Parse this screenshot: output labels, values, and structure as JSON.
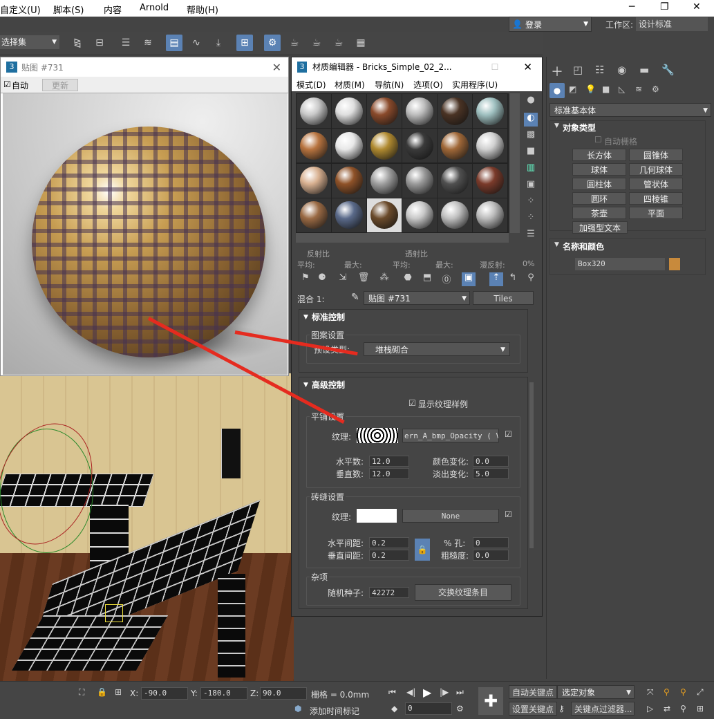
{
  "menubar": {
    "items": [
      "自定义(U)",
      "脚本(S)",
      "内容",
      "Arnold",
      "帮助(H)"
    ],
    "login": "登录",
    "workspace_label": "工作区:",
    "workspace_value": "设计标准"
  },
  "toolbar": {
    "selection_set": "选择集"
  },
  "map_window": {
    "title": "贴图 #731",
    "auto_label": "自动",
    "update_label": "更新"
  },
  "material_editor": {
    "title": "材质编辑器 - Bricks_Simple_02_2...",
    "menu": [
      "模式(D)",
      "材质(M)",
      "导航(N)",
      "选项(O)",
      "实用程序(U)"
    ],
    "reflect_label": "反射比",
    "transmit_label": "透射比",
    "avg_label": "平均:",
    "max_label": "最大:",
    "diffuse_label": "漫反射:",
    "diffuse_value": "0%",
    "mix_label": "混合 1:",
    "map_dropdown": "贴图 #731",
    "map_type_button": "Tiles",
    "standard_controls": {
      "title": "标准控制",
      "pattern_group": "图案设置",
      "preset_label": "预设类型:",
      "preset_value": "堆栈砌合"
    },
    "advanced_controls": {
      "title": "高级控制",
      "show_texture_swatches": "显示纹理样例",
      "tiles_setup_group": "平铺设置",
      "texture_label": "纹理:",
      "texture_map": "ern_A_bmp_Opacity  ( VR",
      "horiz_count_label": "水平数:",
      "horiz_count": "12.0",
      "vert_count_label": "垂直数:",
      "vert_count": "12.0",
      "color_var_label": "颜色变化:",
      "color_var": "0.0",
      "fade_var_label": "淡出变化:",
      "fade_var": "5.0",
      "grout_group": "砖缝设置",
      "grout_texture_label": "纹理:",
      "grout_map": "None",
      "h_gap_label": "水平间距:",
      "h_gap": "0.2",
      "v_gap_label": "垂直间距:",
      "v_gap": "0.2",
      "holes_label": "% 孔:",
      "holes": "0",
      "rough_label": "粗糙度:",
      "rough": "0.0",
      "misc_group": "杂项",
      "seed_label": "随机种子:",
      "seed": "42272",
      "swap_button": "交换纹理条目"
    },
    "slot_colors": [
      "#c9c9c9",
      "#dedede",
      "#8a4a2b",
      "#bdbdbd",
      "#4a3324",
      "#9fc0c0",
      "#b8743f",
      "#e8e8e8",
      "#b08a30",
      "#3a3a3a",
      "#a06838",
      "#d0d0d0",
      "#d8b090",
      "#8f5228",
      "#a0a0a0",
      "#9a9a9a",
      "#505050",
      "#7a3a2a",
      "#9a6a44",
      "#5a6a8a",
      "#6a4a2a",
      "#c8c8c8",
      "#c0c0c0",
      "#bcbcbc"
    ]
  },
  "command_panel": {
    "category": "标准基本体",
    "object_type_title": "对象类型",
    "autogrid": "自动栅格",
    "buttons": [
      "长方体",
      "圆锥体",
      "球体",
      "几何球体",
      "圆柱体",
      "管状体",
      "圆环",
      "四棱锥",
      "茶壶",
      "平面",
      "加强型文本"
    ],
    "name_color_title": "名称和颜色",
    "object_name": "Box320",
    "object_color": "#c88a3c"
  },
  "status_bar": {
    "x_label": "X:",
    "x_value": "-90.0",
    "y_label": "Y:",
    "y_value": "-180.0",
    "z_label": "Z:",
    "z_value": "90.0",
    "grid_label": "栅格 = 0.0mm",
    "add_time_tag": "添加时间标记",
    "frame_value": "0",
    "auto_key": "自动关键点",
    "selected_object": "选定对象",
    "set_key": "设置关键点",
    "key_filters": "关键点过滤器..."
  }
}
